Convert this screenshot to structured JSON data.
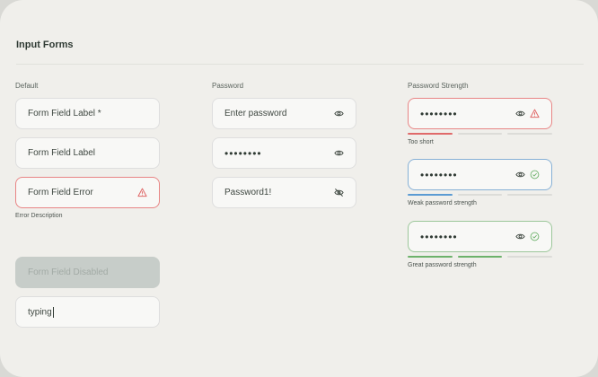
{
  "page": {
    "title": "Input Forms"
  },
  "default": {
    "label": "Default",
    "field_required": "Form Field Label *",
    "field_label": "Form Field Label",
    "field_error": "Form Field Error",
    "error_description": "Error Description",
    "field_disabled": "Form Field Disabled",
    "field_typing": "typing"
  },
  "password": {
    "label": "Password",
    "placeholder": "Enter password",
    "masked": "••••••••",
    "revealed": "Password1!"
  },
  "strength": {
    "label": "Password Strength",
    "masked": "••••••••",
    "items": [
      {
        "status": "Too short",
        "level": 1,
        "color": "#e06a6a"
      },
      {
        "status": "Weak password strength",
        "level": 1,
        "color": "#5b9bd3"
      },
      {
        "status": "Great password strength",
        "level": 2,
        "color": "#6db26b"
      }
    ]
  },
  "colors": {
    "error": "#e06a6a",
    "weak": "#5b9bd3",
    "great": "#6db26b",
    "text": "#2f3a33"
  },
  "icons": {
    "eye": "eye-icon",
    "eye_off": "eye-off-icon",
    "warning": "warning-icon",
    "check": "check-circle-icon"
  }
}
